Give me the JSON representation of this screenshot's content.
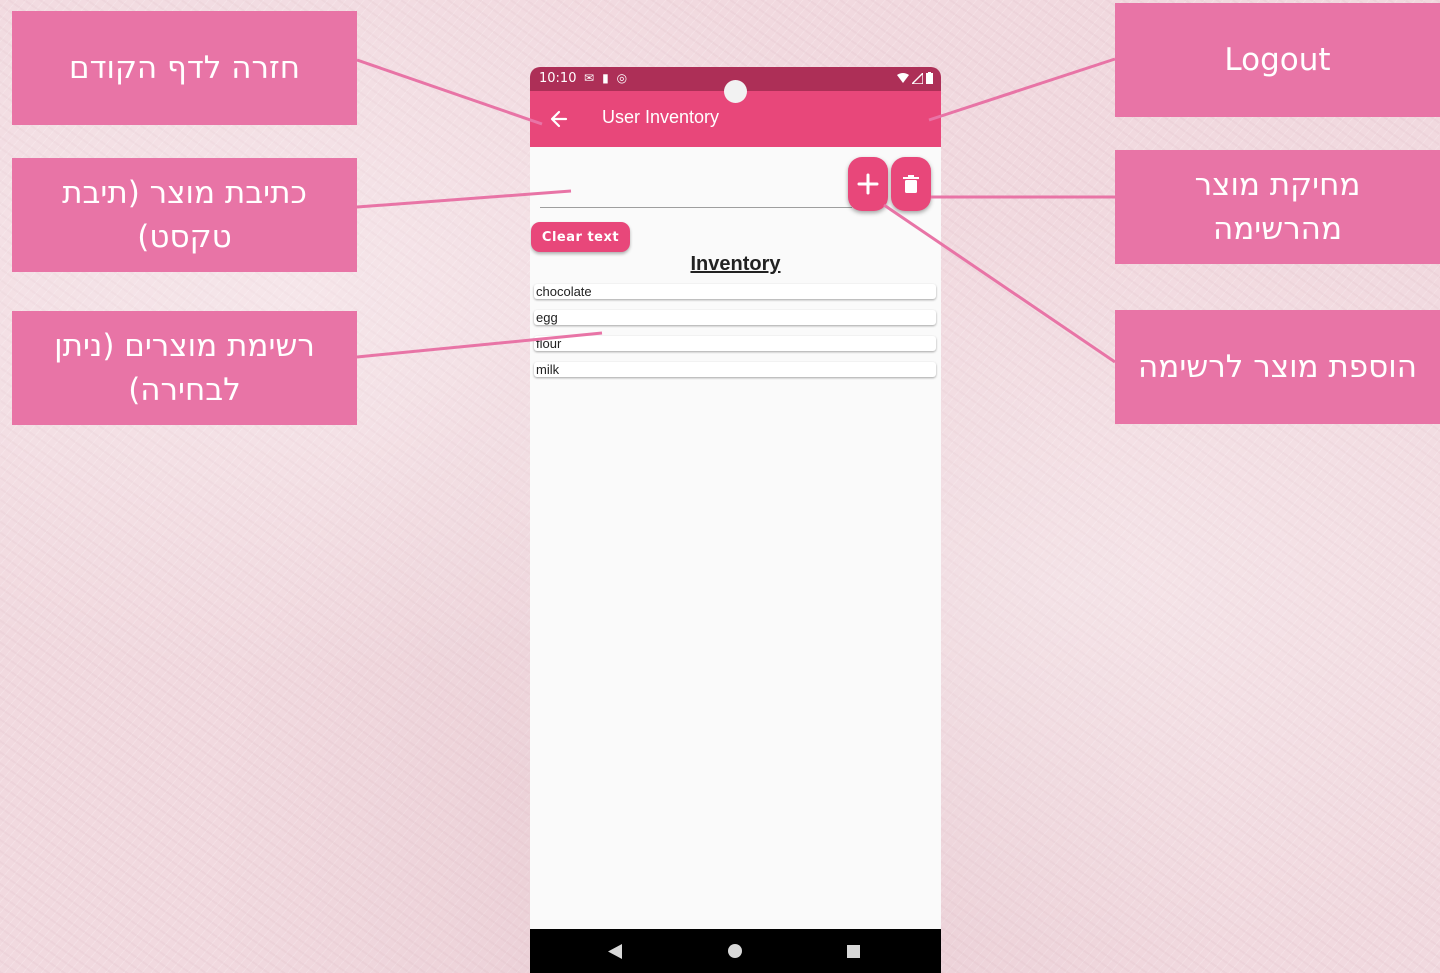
{
  "annotations": {
    "back": "חזרה לדף הקודם",
    "text_input": "כתיבת מוצר (תיבת טקסט)",
    "product_list": "רשימת מוצרים (ניתן לבחירה)",
    "logout": "Logout",
    "delete_product": "מחיקת מוצר מהרשימה",
    "add_product": "הוספת מוצר לרשימה"
  },
  "phone": {
    "status_time": "10:10",
    "appbar_title": "User Inventory",
    "input_value": "",
    "clear_button": "Clear text",
    "inventory_title": "Inventory",
    "inventory_items": [
      "chocolate",
      "egg",
      "flour",
      "milk"
    ]
  },
  "icons": {
    "back": "arrow-left-icon",
    "add": "plus-icon",
    "delete": "trash-icon",
    "nav_back": "triangle-back-icon",
    "nav_home": "circle-home-icon",
    "nav_recent": "square-recent-icon"
  },
  "colors": {
    "callout": "#e874a6",
    "appbar": "#e8477a",
    "statusbar": "#ad2f57",
    "background": "#f1d9df"
  }
}
